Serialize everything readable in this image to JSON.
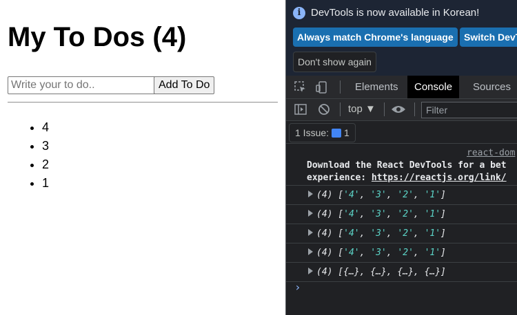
{
  "app": {
    "title": "My To Dos (4)",
    "input_placeholder": "Write your to do..",
    "add_label": "Add To Do",
    "todos": [
      "4",
      "3",
      "2",
      "1"
    ]
  },
  "devtools": {
    "info_text": "DevTools is now available in Korean!",
    "btn_match": "Always match Chrome's language",
    "btn_switch": "Switch DevT",
    "btn_dont_show": "Don't show again",
    "tabs": [
      "Elements",
      "Console",
      "Sources"
    ],
    "context": "top ▼",
    "filter_placeholder": "Filter",
    "issues_label": "1 Issue:",
    "issues_count": "1",
    "react_source": "react-dom",
    "react_line1": "Download the React DevTools for a bet",
    "react_line2_prefix": "experience: ",
    "react_line2_link": "https://reactjs.org/link/",
    "logs": [
      {
        "count": "(4)",
        "items": [
          "'4'",
          "'3'",
          "'2'",
          "'1'"
        ]
      },
      {
        "count": "(4)",
        "items": [
          "'4'",
          "'3'",
          "'2'",
          "'1'"
        ]
      },
      {
        "count": "(4)",
        "items": [
          "'4'",
          "'3'",
          "'2'",
          "'1'"
        ]
      },
      {
        "count": "(4)",
        "items": [
          "'4'",
          "'3'",
          "'2'",
          "'1'"
        ]
      },
      {
        "count": "(4)",
        "items": [
          "{…}",
          "{…}",
          "{…}",
          "{…}"
        ]
      }
    ],
    "prompt": "›"
  },
  "colors": {
    "devtools_bg": "#202124",
    "accent_blue": "#1a6fb0",
    "string_teal": "#5cd5c8"
  }
}
